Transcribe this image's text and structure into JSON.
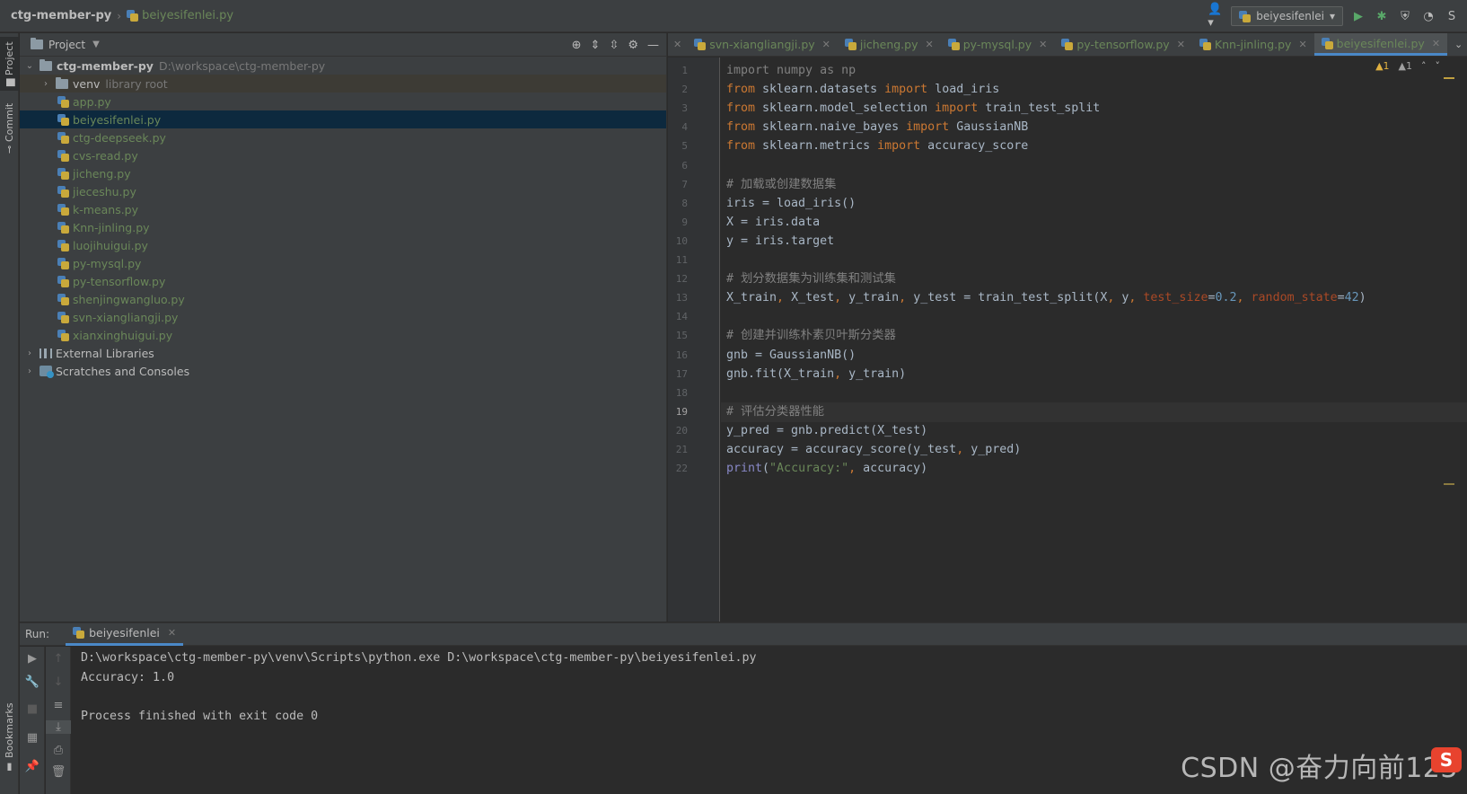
{
  "navbar": {
    "project": "ctg-member-py",
    "file": "beiyesifenlei.py",
    "run_config": "beiyesifenlei"
  },
  "left_strip": {
    "project_tab": "Project",
    "commit_tab": "Commit",
    "bookmarks_tab": "Bookmarks"
  },
  "project_panel": {
    "title": "Project",
    "root": {
      "name": "ctg-member-py",
      "path": "D:\\workspace\\ctg-member-py"
    },
    "venv": {
      "name": "venv",
      "hint": "library root"
    },
    "files": [
      "app.py",
      "beiyesifenlei.py",
      "ctg-deepseek.py",
      "cvs-read.py",
      "jicheng.py",
      "jieceshu.py",
      "k-means.py",
      "Knn-jinling.py",
      "luojihuigui.py",
      "py-mysql.py",
      "py-tensorflow.py",
      "shenjingwangluo.py",
      "svn-xiangliangji.py",
      "xianxinghuigui.py"
    ],
    "external_libraries": "External Libraries",
    "scratches": "Scratches and Consoles"
  },
  "editor": {
    "tabs": [
      {
        "label": "svn-xiangliangji.py",
        "active": false
      },
      {
        "label": "jicheng.py",
        "active": false
      },
      {
        "label": "py-mysql.py",
        "active": false
      },
      {
        "label": "py-tensorflow.py",
        "active": false
      },
      {
        "label": "Knn-jinling.py",
        "active": false
      },
      {
        "label": "beiyesifenlei.py",
        "active": true
      }
    ],
    "inspections": {
      "warnings": "1",
      "weak_warnings": "1"
    },
    "current_line": 19,
    "lines": [
      "import numpy as np",
      "from sklearn.datasets import load_iris",
      "from sklearn.model_selection import train_test_split",
      "from sklearn.naive_bayes import GaussianNB",
      "from sklearn.metrics import accuracy_score",
      "",
      "# 加载或创建数据集",
      "iris = load_iris()",
      "X = iris.data",
      "y = iris.target",
      "",
      "# 划分数据集为训练集和测试集",
      "X_train, X_test, y_train, y_test = train_test_split(X, y, test_size=0.2, random_state=42)",
      "",
      "# 创建并训练朴素贝叶斯分类器",
      "gnb = GaussianNB()",
      "gnb.fit(X_train, y_train)",
      "",
      "# 评估分类器性能",
      "y_pred = gnb.predict(X_test)",
      "accuracy = accuracy_score(y_test, y_pred)",
      "print(\"Accuracy:\", accuracy)"
    ]
  },
  "run_panel": {
    "label": "Run:",
    "tab": "beiyesifenlei",
    "output": [
      "D:\\workspace\\ctg-member-py\\venv\\Scripts\\python.exe D:\\workspace\\ctg-member-py\\beiyesifenlei.py",
      "Accuracy: 1.0",
      "",
      "Process finished with exit code 0"
    ]
  },
  "watermark": "CSDN @奋力向前123"
}
